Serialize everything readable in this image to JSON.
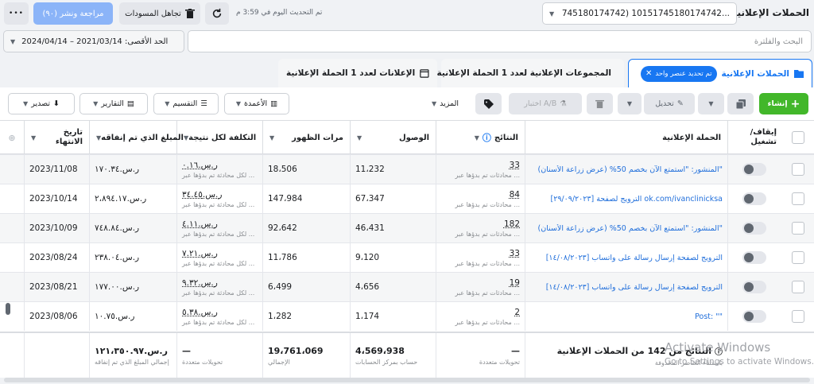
{
  "top": {
    "title": "الحملات الإعلانية",
    "account": "745180174742) 10151745180174742...",
    "updated": "تم التحديث اليوم في 3:59 م",
    "discard": "تجاهل المسودات",
    "review": "مراجعة ونشر (٩٠)",
    "more": "•••"
  },
  "search": {
    "placeholder": "البحث والفلترة",
    "date_range": "الحد الأقصى: 2021/03/14 – 2024/04/14"
  },
  "tabs": {
    "campaigns": "الحملات الإعلانية",
    "selected_chip": "تم تحديد عنصر واحد",
    "adsets": "المجموعات الإعلانية لعدد 1 الحملة الإعلانية",
    "ads": "الإعلانات لعدد 1 الحملة الإعلانية"
  },
  "toolbar": {
    "create": "إنشاء",
    "edit": "تحديل",
    "ab_test": "اختبار A/B",
    "more": "المزيد",
    "columns": "الأعمدة",
    "breakdown": "التقسيم",
    "reports": "التقارير",
    "export": "تصدير"
  },
  "headers": {
    "toggle": "إيقاف/ تشغيل",
    "campaign": "الحملة الإعلانية",
    "results": "النتائج",
    "reach": "الوصول",
    "impressions": "مرات الظهور",
    "cost": "التكلفة لكل نتيجة",
    "spent": "المبلغ الذي تم إنفاقه",
    "end_date": "تاريخ الانتهاء"
  },
  "rows": [
    {
      "campaign": "المنشور: \"استمتع الآن بخصم 50% (عرض زراعة الأسنان)\"",
      "results": "33",
      "results_sub": "محادثات تم بدؤها عبر ...",
      "reach": "11،232",
      "impressions": "18،506",
      "cost": "ر.س.٠.١٦",
      "cost_sub": "لكل محادثة تم بدؤها عبر ...",
      "spent": "ر.س.١٧٠.٣٤",
      "end": "2023/11/08"
    },
    {
      "campaign": "[٢٩/٠٩/٢٠٢٣] الترويج لصفحة ok.com/ivanclinicksa",
      "results": "84",
      "results_sub": "محادثات تم بدؤها عبر ...",
      "reach": "67،347",
      "impressions": "147،984",
      "cost": "ر.س.٣٤.٤٥",
      "cost_sub": "لكل محادثة تم بدؤها عبر ...",
      "spent": "ر.س.٢،٨٩٤.١٧",
      "end": "2023/10/14"
    },
    {
      "campaign": "المنشور: \"استمتع الآن بخصم 50% (عرض زراعة الأسنان)\"",
      "results": "182",
      "results_sub": "محادثات تم بدؤها عبر ...",
      "reach": "46،431",
      "impressions": "92،642",
      "cost": "ر.س.٤.١١",
      "cost_sub": "لكل محادثة تم بدؤها عبر ...",
      "spent": "ر.س.٧٤٨.٨٤",
      "end": "2023/10/09"
    },
    {
      "campaign": "[١٤/٠٨/٢٠٢٣] الترويج لصفحة إرسال رسالة على واتساب",
      "results": "33",
      "results_sub": "محادثات تم بدؤها عبر ...",
      "reach": "9،120",
      "impressions": "11،786",
      "cost": "ر.س.٧.٢١",
      "cost_sub": "لكل محادثة تم بدؤها عبر ...",
      "spent": "ر.س.٢٣٨.٠٤",
      "end": "2023/08/24"
    },
    {
      "campaign": "[١٤/٠٨/٢٠٢٣] الترويج لصفحة إرسال رسالة على واتساب",
      "results": "19",
      "results_sub": "محادثات تم بدؤها عبر ...",
      "reach": "4،656",
      "impressions": "6،499",
      "cost": "ر.س.٩.٣٢",
      "cost_sub": "لكل محادثة تم بدؤها عبر ...",
      "spent": "ر.س.١٧٧.٠٠",
      "end": "2023/08/21"
    },
    {
      "campaign": "Post: \"\"",
      "results": "2",
      "results_sub": "محادثات تم بدؤها عبر ...",
      "reach": "1،174",
      "impressions": "1،282",
      "cost": "ر.س.٥.٣٨",
      "cost_sub": "لكل محادثة تم بدؤها عبر ...",
      "spent": "ر.س.١٠.٧٥",
      "end": "2023/08/06"
    }
  ],
  "footer": {
    "label": "النتائج من 142 من الحملات الإعلانية",
    "label_sub": "باستثناء العناصر المحذوفة",
    "results": "—",
    "results_sub": "تحويلات متعددة",
    "reach": "4،569،938",
    "reach_sub": "حساب بمركز الحسابات",
    "impressions": "19،761،069",
    "impressions_sub": "الإجمالي",
    "cost": "—",
    "cost_sub": "تحويلات متعددة",
    "spent": "ر.س.١٢١،٣٥٠.٩٧",
    "spent_sub": "إجمالي المبلغ الذي تم إنفاقه"
  },
  "watermark": {
    "title": "Activate Windows",
    "sub": "Go to Settings to activate Windows."
  },
  "colors": {
    "accent": "#1877f2",
    "create": "#42b72a",
    "link": "#216fdb"
  }
}
